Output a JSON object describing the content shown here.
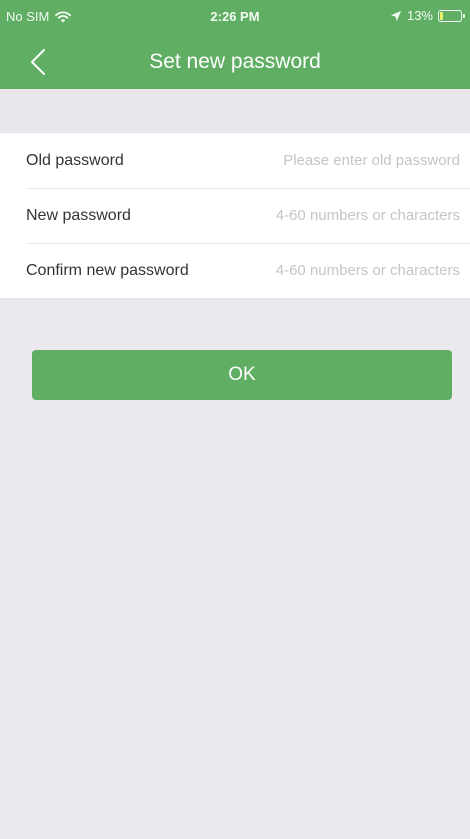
{
  "status_bar": {
    "carrier": "No SIM",
    "time": "2:26 PM",
    "battery": "13%",
    "battery_level": 0.13,
    "icons": [
      "wifi-icon",
      "location-arrow-icon",
      "battery-icon"
    ]
  },
  "nav": {
    "title": "Set new password",
    "back_icon": "chevron-left-icon"
  },
  "form": {
    "fields": [
      {
        "label": "Old password",
        "placeholder": "Please enter old password",
        "value": ""
      },
      {
        "label": "New password",
        "placeholder": "4-60 numbers or characters",
        "value": ""
      },
      {
        "label": "Confirm new password",
        "placeholder": "4-60 numbers or characters",
        "value": ""
      }
    ]
  },
  "actions": {
    "ok_label": "OK"
  },
  "colors": {
    "accent": "#5fae64",
    "background": "#ebe9ee",
    "placeholder": "#c5c5c9",
    "label": "#333333"
  }
}
